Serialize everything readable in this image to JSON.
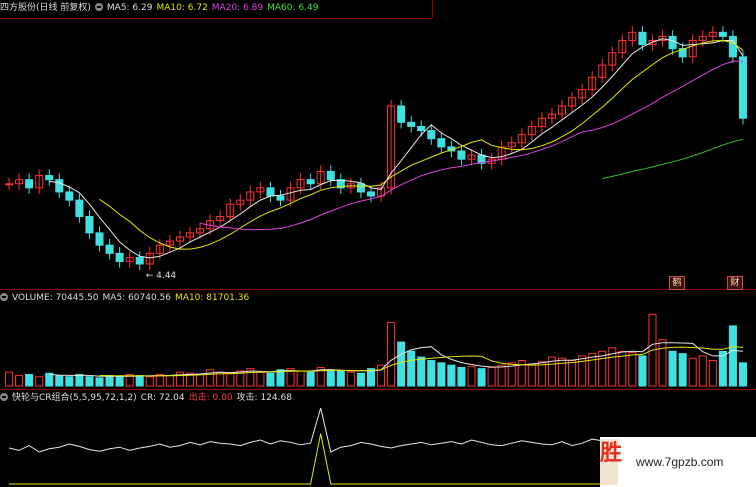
{
  "colors": {
    "up": "#ff3030",
    "down": "#40e0e0",
    "ma5": "#e6e6e6",
    "ma10": "#e6e600",
    "ma20": "#e040e0",
    "ma60": "#30c030",
    "grid": "#8b0000",
    "cr": "#e6e6e6",
    "cr_out": "#e6e600"
  },
  "price_header": {
    "title": "四方股份(日线 前复权)",
    "ma5": "MA5: 6.29",
    "ma10": "MA10: 6.72",
    "ma20": "MA20: 6.89",
    "ma60": "MA60: 6.49"
  },
  "price_annotation": "4.44",
  "badges": {
    "b1": "鹤",
    "b2": "财"
  },
  "vol_header": {
    "volume": "VOLUME: 70445.50",
    "ma5": "MA5: 60740.56",
    "ma10": "MA10: 81701.36"
  },
  "cr_header": {
    "title": "快轮与CR组合(5,5,95,72,1,2)",
    "cr": "CR: 72.04",
    "out": "出击: 0.00",
    "attack": "攻击: 124.68"
  },
  "watermark": {
    "mark": "胜",
    "text": "www.7gpzb.com"
  },
  "chart_data": {
    "type": "candlestick",
    "title": "四方股份(日线 前复权)",
    "price_closes": [
      6.4,
      6.5,
      6.3,
      6.6,
      6.5,
      6.2,
      6.0,
      5.6,
      5.2,
      4.9,
      4.7,
      4.5,
      4.6,
      4.44,
      4.7,
      4.9,
      5.0,
      5.1,
      5.2,
      5.3,
      5.5,
      5.6,
      5.9,
      6.0,
      6.2,
      6.3,
      6.1,
      6.0,
      6.3,
      6.5,
      6.4,
      6.7,
      6.5,
      6.3,
      6.4,
      6.2,
      6.1,
      6.3,
      8.3,
      7.9,
      7.8,
      7.7,
      7.5,
      7.3,
      7.2,
      7.0,
      7.1,
      6.9,
      7.0,
      7.3,
      7.4,
      7.6,
      7.8,
      8.0,
      8.1,
      8.3,
      8.5,
      8.7,
      9.0,
      9.3,
      9.6,
      9.9,
      10.1,
      9.8,
      9.9,
      10.0,
      9.7,
      9.5,
      9.9,
      10.0,
      10.1,
      10.0,
      9.5,
      8.0
    ],
    "volume": [
      12,
      9,
      10,
      8,
      11,
      9,
      8,
      10,
      8,
      7,
      9,
      8,
      10,
      9,
      8,
      10,
      9,
      12,
      11,
      10,
      14,
      12,
      11,
      13,
      15,
      12,
      11,
      14,
      15,
      13,
      12,
      16,
      14,
      13,
      12,
      11,
      15,
      18,
      55,
      38,
      30,
      25,
      22,
      20,
      18,
      16,
      17,
      15,
      16,
      18,
      20,
      22,
      19,
      21,
      25,
      24,
      22,
      26,
      28,
      30,
      33,
      30,
      29,
      26,
      62,
      40,
      30,
      28,
      24,
      26,
      22,
      30,
      52,
      20
    ],
    "cr_values": [
      45,
      42,
      48,
      40,
      44,
      46,
      50,
      47,
      43,
      41,
      44,
      46,
      42,
      45,
      47,
      50,
      46,
      48,
      52,
      49,
      53,
      51,
      50,
      48,
      52,
      55,
      50,
      54,
      52,
      49,
      51,
      95,
      40,
      46,
      48,
      52,
      50,
      47,
      45,
      48,
      50,
      52,
      49,
      51,
      53,
      50,
      55,
      52,
      49,
      48,
      51,
      54,
      52,
      50,
      49,
      53,
      48,
      51,
      56,
      54,
      52,
      55,
      53,
      51,
      49,
      52,
      54,
      51,
      50,
      48,
      46,
      50,
      45,
      48
    ]
  }
}
